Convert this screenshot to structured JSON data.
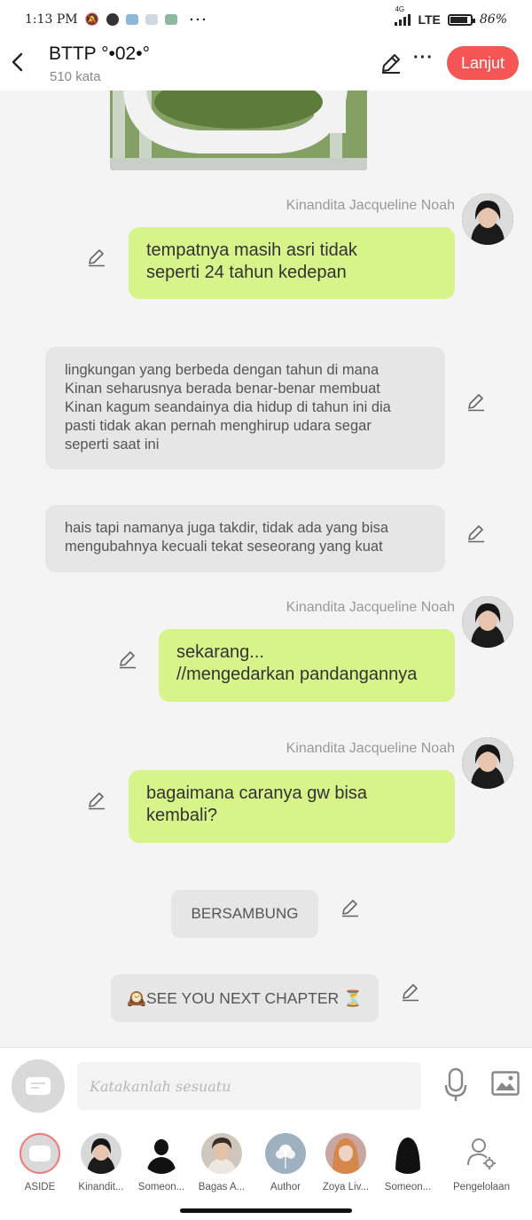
{
  "status_bar": {
    "time": "1:13 PM",
    "network": "LTE",
    "network_small": "4G",
    "battery": "86%"
  },
  "header": {
    "title": "BTTP °•02•°",
    "word_count": "510 kata",
    "next_label": "Lanjut",
    "accent_color": "#f55555"
  },
  "messages": [
    {
      "sender": "Kinandita Jacqueline  Noah",
      "text_lines": [
        "tempatnya masih asri tidak",
        "seperti 24 tahun kedepan"
      ]
    },
    {
      "narration_lines": [
        "lingkungan yang berbeda dengan tahun di mana",
        "Kinan seharusnya berada benar-benar membuat",
        "Kinan kagum seandainya dia hidup di tahun ini dia",
        "pasti tidak akan pernah menghirup udara segar",
        "seperti saat ini"
      ]
    },
    {
      "narration_lines": [
        "hais tapi namanya juga takdir, tidak ada yang bisa",
        "mengubahnya kecuali tekat seseorang yang kuat"
      ]
    },
    {
      "sender": "Kinandita Jacqueline  Noah",
      "text_lines": [
        "sekarang...",
        "//mengedarkan pandangannya"
      ]
    },
    {
      "sender": "Kinandita Jacqueline  Noah",
      "text_lines": [
        "bagaimana caranya gw bisa",
        "kembali?"
      ]
    },
    {
      "center_text": "BERSAMBUNG"
    },
    {
      "center_text": "🕰️SEE YOU NEXT CHAPTER ⏳"
    }
  ],
  "input": {
    "placeholder": "Katakanlah sesuatu"
  },
  "characters": [
    {
      "name": "ASIDE"
    },
    {
      "name": "Kinandit..."
    },
    {
      "name": "Someon..."
    },
    {
      "name": "Bagas A..."
    },
    {
      "name": "Author"
    },
    {
      "name": "Zoya Liv..."
    },
    {
      "name": "Someon..."
    },
    {
      "name": "Pengelolaan"
    }
  ],
  "colors": {
    "bubble_green": "#d6f48a",
    "bubble_gray": "#e6e6e6"
  }
}
